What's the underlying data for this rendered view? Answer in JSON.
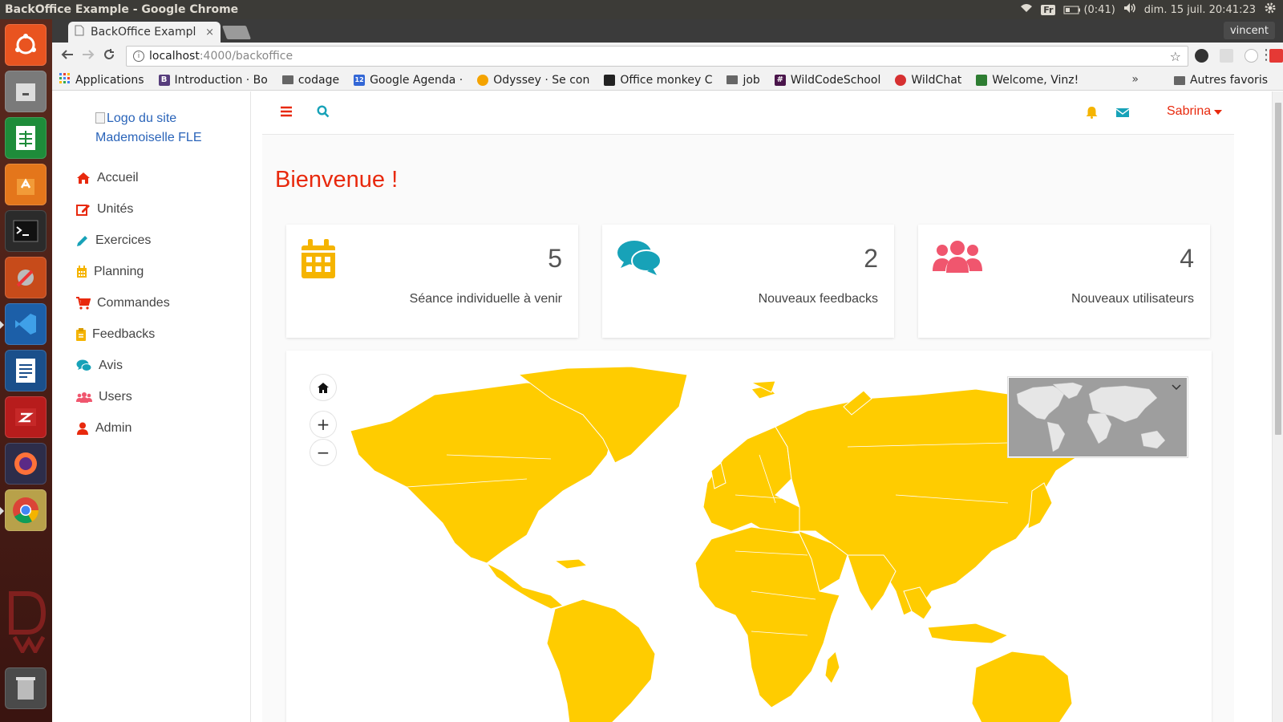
{
  "os": {
    "window_title": "BackOffice Example - Google Chrome",
    "keyboard_layout": "Fr",
    "battery": "(0:41)",
    "datetime": "dim. 15 juil. 20:41:23"
  },
  "browser": {
    "tab_title": "BackOffice Exampl",
    "tab_close": "×",
    "profile_name": "vincent",
    "url_host": "localhost",
    "url_path": ":4000/backoffice",
    "bookmarks": [
      {
        "label": "Applications",
        "color": "#4285f4"
      },
      {
        "label": "Introduction · Bo",
        "color": "#563d7c"
      },
      {
        "label": "codage",
        "color": "#666666"
      },
      {
        "label": "Google Agenda ·",
        "color": "#3367d6"
      },
      {
        "label": "Odyssey · Se con",
        "color": "#f4a300"
      },
      {
        "label": "Office monkey C",
        "color": "#222222"
      },
      {
        "label": "job",
        "color": "#666666"
      },
      {
        "label": "WildCodeSchool",
        "color": "#4a154b"
      },
      {
        "label": "WildChat",
        "color": "#d63031"
      },
      {
        "label": "Welcome, Vinz!",
        "color": "#2e7d32"
      }
    ],
    "bookmarks_more": "»",
    "other_bookmarks": "Autres favoris"
  },
  "app": {
    "logo_alt_line1": "Logo du site",
    "logo_alt_line2": "Mademoiselle FLE",
    "nav": [
      {
        "label": "Accueil",
        "icon": "home-icon"
      },
      {
        "label": "Unités",
        "icon": "edit-icon"
      },
      {
        "label": "Exercices",
        "icon": "pencil-icon"
      },
      {
        "label": "Planning",
        "icon": "calendar-icon"
      },
      {
        "label": "Commandes",
        "icon": "cart-icon"
      },
      {
        "label": "Feedbacks",
        "icon": "clipboard-icon"
      },
      {
        "label": "Avis",
        "icon": "comments-icon"
      },
      {
        "label": "Users",
        "icon": "users-icon"
      },
      {
        "label": "Admin",
        "icon": "user-icon"
      }
    ],
    "user_name": "Sabrina",
    "welcome": "Bienvenue !",
    "cards": [
      {
        "count": "5",
        "label": "Séance individuelle à venir",
        "icon": "calendar-icon",
        "color": "#f5b400"
      },
      {
        "count": "2",
        "label": "Nouveaux feedbacks",
        "icon": "comments-icon",
        "color": "#17a2b8"
      },
      {
        "count": "4",
        "label": "Nouveaux utilisateurs",
        "icon": "users-icon",
        "color": "#f0566e"
      }
    ],
    "map": {
      "zoom_in": "+",
      "zoom_out": "−",
      "land_color": "#ffcc00"
    }
  },
  "colors": {
    "accent_red": "#e8290d",
    "teal": "#17a2b8",
    "amber": "#f5b400",
    "pink": "#f0566e"
  }
}
